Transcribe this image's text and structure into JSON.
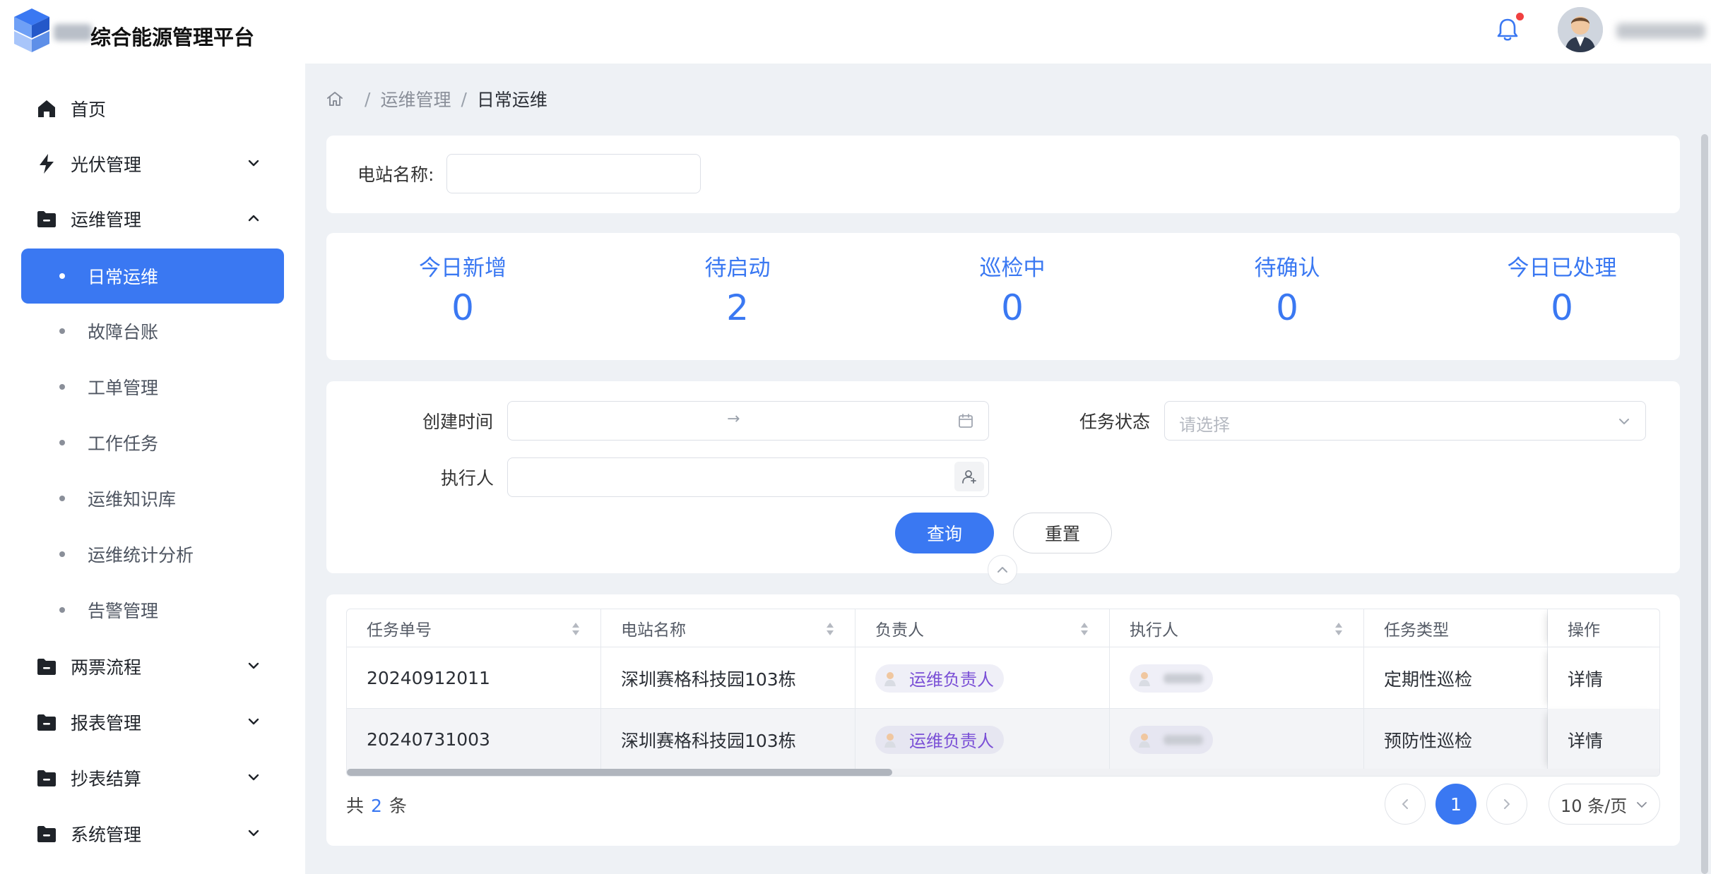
{
  "header": {
    "app_title": "综合能源管理平台",
    "has_notification": true
  },
  "sidebar": {
    "items": [
      {
        "label": "首页",
        "icon": "home-icon",
        "expandable": false
      },
      {
        "label": "光伏管理",
        "icon": "bolt-icon",
        "expandable": true,
        "expanded": false
      },
      {
        "label": "运维管理",
        "icon": "folder-icon",
        "expandable": true,
        "expanded": true,
        "children": [
          {
            "label": "日常运维",
            "active": true
          },
          {
            "label": "故障台账"
          },
          {
            "label": "工单管理"
          },
          {
            "label": "工作任务"
          },
          {
            "label": "运维知识库"
          },
          {
            "label": "运维统计分析"
          },
          {
            "label": "告警管理"
          }
        ]
      },
      {
        "label": "两票流程",
        "icon": "folder-icon",
        "expandable": true,
        "expanded": false
      },
      {
        "label": "报表管理",
        "icon": "folder-icon",
        "expandable": true,
        "expanded": false
      },
      {
        "label": "抄表结算",
        "icon": "folder-icon",
        "expandable": true,
        "expanded": false
      },
      {
        "label": "系统管理",
        "icon": "folder-icon",
        "expandable": true,
        "expanded": false
      }
    ]
  },
  "breadcrumb": {
    "items": [
      "运维管理",
      "日常运维"
    ],
    "separator": "/"
  },
  "station_filter": {
    "label": "电站名称:",
    "value": ""
  },
  "stats": [
    {
      "label": "今日新增",
      "value": "0"
    },
    {
      "label": "待启动",
      "value": "2"
    },
    {
      "label": "巡检中",
      "value": "0"
    },
    {
      "label": "待确认",
      "value": "0"
    },
    {
      "label": "今日已处理",
      "value": "0"
    }
  ],
  "search_form": {
    "created_time_label": "创建时间",
    "date_range_separator": "→",
    "task_status_label": "任务状态",
    "task_status_placeholder": "请选择",
    "executor_label": "执行人",
    "executor_value": "",
    "query_button": "查询",
    "reset_button": "重置"
  },
  "table": {
    "columns": [
      "任务单号",
      "电站名称",
      "负责人",
      "执行人",
      "任务类型",
      "操作"
    ],
    "rows": [
      {
        "task_no": "20240912011",
        "station": "深圳赛格科技园103栋",
        "owner": "运维负责人",
        "task_type": "定期性巡检",
        "action": "详情"
      },
      {
        "task_no": "20240731003",
        "station": "深圳赛格科技园103栋",
        "owner": "运维负责人",
        "task_type": "预防性巡检",
        "action": "详情"
      }
    ]
  },
  "pagination": {
    "total_prefix": "共",
    "total": "2",
    "total_suffix": "条",
    "current_page": "1",
    "page_size": "10 条/页"
  },
  "colors": {
    "primary": "#3a78f2",
    "owner_tag_text": "#7a4fd6",
    "notification_dot": "#f04040"
  }
}
